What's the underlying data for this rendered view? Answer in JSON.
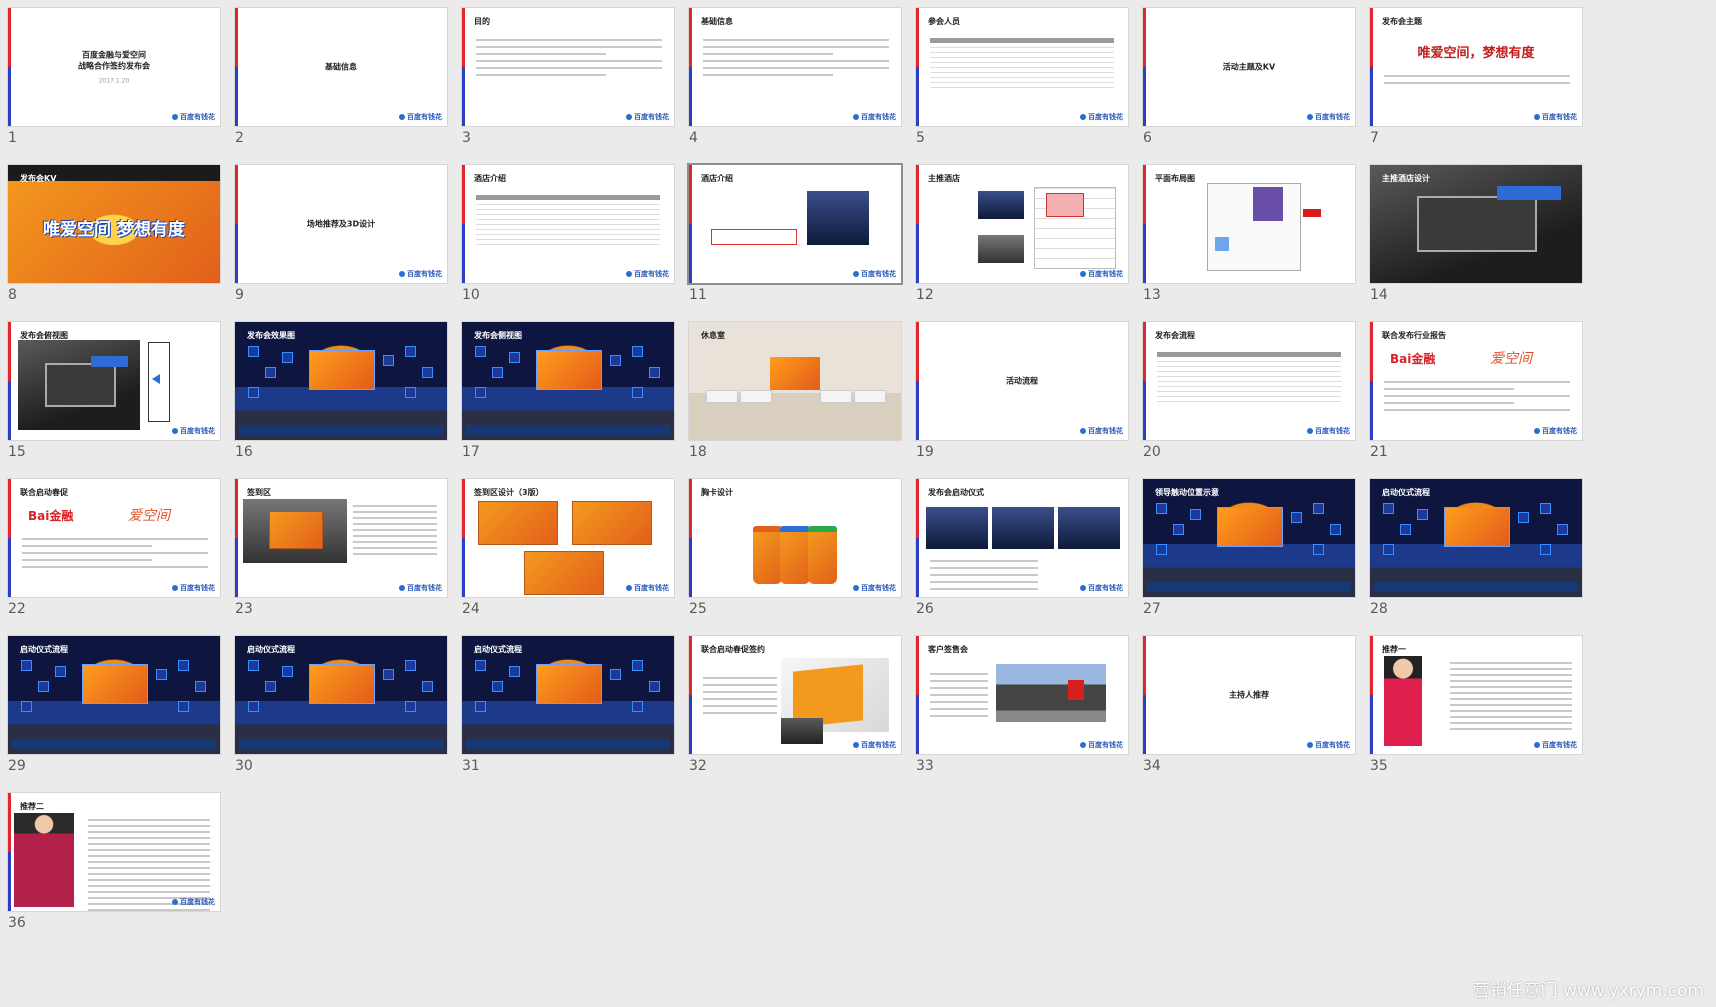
{
  "app": {
    "watermark": "营销任意门 www.yxrym.com"
  },
  "colors": {
    "accent_red": "#e0262f",
    "accent_blue": "#2b3fc4",
    "kv_orange": "#f39a1e",
    "logo_blue": "#2a5ab8"
  },
  "slides": [
    {
      "num": "1",
      "style": "cover",
      "title": "百度金融与爱空间\n战略合作签约发布会",
      "subtitle": "2017.1.20"
    },
    {
      "num": "2",
      "style": "center",
      "title": "基础信息"
    },
    {
      "num": "3",
      "style": "bullets",
      "title": "目的"
    },
    {
      "num": "4",
      "style": "bullets",
      "title": "基础信息"
    },
    {
      "num": "5",
      "style": "table",
      "title": "参会人员"
    },
    {
      "num": "6",
      "style": "center",
      "title": "活动主题及KV"
    },
    {
      "num": "7",
      "style": "theme",
      "title": "发布会主题",
      "headline": "唯爱空间，梦想有度"
    },
    {
      "num": "8",
      "style": "kv",
      "title": "发布会KV",
      "kv_text": "唯爱空间 梦想有度"
    },
    {
      "num": "9",
      "style": "center",
      "title": "场地推荐及3D设计"
    },
    {
      "num": "10",
      "style": "table",
      "title": "酒店介绍"
    },
    {
      "num": "11",
      "style": "hotel",
      "title": "酒店介绍",
      "selected": true
    },
    {
      "num": "12",
      "style": "hotel2",
      "title": "主推酒店"
    },
    {
      "num": "13",
      "style": "plan",
      "title": "平面布局图"
    },
    {
      "num": "14",
      "style": "3d",
      "title": "主推酒店设计"
    },
    {
      "num": "15",
      "style": "3dside",
      "title": "发布会俯视图"
    },
    {
      "num": "16",
      "style": "stage",
      "title": "发布会效果图"
    },
    {
      "num": "17",
      "style": "stage",
      "title": "发布会侧视图"
    },
    {
      "num": "18",
      "style": "room",
      "title": "休息室"
    },
    {
      "num": "19",
      "style": "center",
      "title": "活动流程"
    },
    {
      "num": "20",
      "style": "table",
      "title": "发布会流程"
    },
    {
      "num": "21",
      "style": "brand",
      "title": "联合发布行业报告"
    },
    {
      "num": "22",
      "style": "brand",
      "title": "联合启动春促"
    },
    {
      "num": "23",
      "style": "signin",
      "title": "签到区"
    },
    {
      "num": "24",
      "style": "signin3",
      "title": "签到区设计（3版）"
    },
    {
      "num": "25",
      "style": "lanyard",
      "title": "胸卡设计"
    },
    {
      "num": "26",
      "style": "launch",
      "title": "发布会启动仪式"
    },
    {
      "num": "27",
      "style": "stage",
      "title": "领导触动位置示意"
    },
    {
      "num": "28",
      "style": "stage",
      "title": "启动仪式流程"
    },
    {
      "num": "29",
      "style": "stage",
      "title": "启动仪式流程"
    },
    {
      "num": "30",
      "style": "stage",
      "title": "启动仪式流程"
    },
    {
      "num": "31",
      "style": "stage",
      "title": "启动仪式流程"
    },
    {
      "num": "32",
      "style": "folder",
      "title": "联合启动春促签约"
    },
    {
      "num": "33",
      "style": "building",
      "title": "客户签售会"
    },
    {
      "num": "34",
      "style": "center",
      "title": "主持人推荐"
    },
    {
      "num": "35",
      "style": "host",
      "title": "推荐一"
    },
    {
      "num": "36",
      "style": "host2",
      "title": "推荐二"
    }
  ],
  "logo_text": "百度有钱花",
  "brand_left": "Bai金融",
  "brand_right": "爱空间"
}
